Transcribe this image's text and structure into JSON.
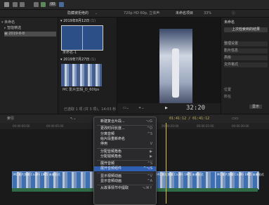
{
  "toolbar": {
    "badge": "00",
    "filter_label": "隐藏被拒绝的",
    "zoom": "120% 10 fps",
    "dims": "720p HD 60p, 立体声",
    "title": "未命名项目",
    "zoom_pct": "33%",
    "view_label": "显示"
  },
  "library": {
    "items": [
      {
        "label": "未命名"
      },
      {
        "label": "智能精选"
      },
      {
        "label": "2019-8-8"
      }
    ]
  },
  "browser": {
    "groups": [
      {
        "date": "2019年8月12日",
        "count": "(1)",
        "clip": "未命名-1"
      },
      {
        "date": "2019年7月27日",
        "count": "(1)",
        "clip": "MC 影片剪辑_D_60fps"
      }
    ],
    "status": "已选取 1 项 (共 3 项)，14:03 秒"
  },
  "viewer": {
    "timecode": "32:20",
    "zoom": "33%"
  },
  "inspector": {
    "title": "未命名",
    "buttons": [
      "上次检索到的结果",
      "整理设置",
      "影片信息",
      "高级",
      "文件格式"
    ],
    "labels": [
      "位置",
      "所在"
    ],
    "button_label": "显示"
  },
  "timeline": {
    "index_label": "索引",
    "position": "01:41:12 / 01:41:12",
    "ruler": [
      "00:00:00:00",
      "00:00:05:00",
      "00:00:10:00",
      "00:00:15:00",
      "00:00:20:00",
      "00:00:25:00",
      "00:00:30:00"
    ],
    "clip_label": "MC 影片剪辑 Cruilfn 1905 未来形式"
  },
  "context_menu": {
    "items": [
      {
        "label": "新建复合片段...",
        "shortcut": "⌥G",
        "highlight": false,
        "arrow": false
      },
      {
        "sep": true
      },
      {
        "label": "更改时间长度...",
        "shortcut": "^D",
        "highlight": false,
        "arrow": false
      },
      {
        "label": "分离音频",
        "shortcut": "^S",
        "highlight": false,
        "arrow": false
      },
      {
        "label": "给片段重新命名",
        "shortcut": "",
        "highlight": false,
        "arrow": false
      },
      {
        "label": "停用",
        "shortcut": "V",
        "highlight": false,
        "arrow": false
      },
      {
        "sep": true
      },
      {
        "label": "分配音频角色",
        "shortcut": "",
        "highlight": false,
        "arrow": true
      },
      {
        "label": "分配视频角色",
        "shortcut": "",
        "highlight": false,
        "arrow": true
      },
      {
        "sep": true
      },
      {
        "label": "展开音频",
        "shortcut": "^S",
        "highlight": false,
        "arrow": false
      },
      {
        "label": "展开音频组件",
        "shortcut": "^⌥S",
        "highlight": true,
        "arrow": false
      },
      {
        "sep": true
      },
      {
        "label": "显示视频动画",
        "shortcut": "^V",
        "highlight": false,
        "arrow": false
      },
      {
        "label": "显示音频动画",
        "shortcut": "^A",
        "highlight": false,
        "arrow": false
      },
      {
        "sep": true
      },
      {
        "label": "从故事情节中提取",
        "shortcut": "⌥⌘↑",
        "highlight": false,
        "arrow": false
      }
    ]
  },
  "colors": {
    "accent": "#2f5fb3",
    "clip": "#3e6fb1",
    "playhead": "#e3c33a"
  }
}
